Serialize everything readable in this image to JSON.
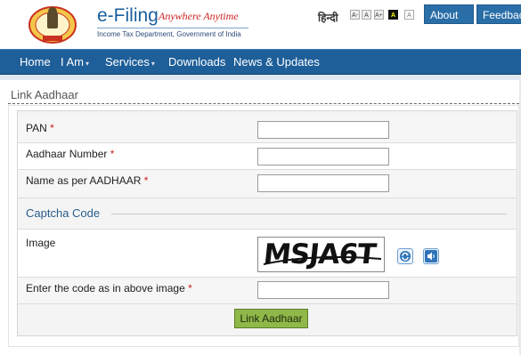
{
  "header": {
    "title": "e-Filing",
    "tagline": "Anywhere Anytime",
    "subtitle": "Income Tax Department, Government of India",
    "language_link": "हिन्दी",
    "font_sizes": [
      "A-",
      "A",
      "A+",
      "A",
      "A"
    ],
    "buttons": {
      "about": "About Us",
      "feedback": "Feedback"
    }
  },
  "nav": {
    "items": [
      {
        "label": "Home"
      },
      {
        "label": "I Am"
      },
      {
        "label": "Services"
      },
      {
        "label": "Downloads"
      },
      {
        "label": "News & Updates"
      }
    ]
  },
  "page": {
    "title": "Link Aadhaar",
    "fields": {
      "pan": {
        "label": "PAN",
        "required": "*",
        "value": ""
      },
      "aadhaar": {
        "label": "Aadhaar Number",
        "required": "*",
        "value": ""
      },
      "name": {
        "label": "Name as per AADHAAR",
        "required": "*",
        "value": ""
      }
    },
    "captcha": {
      "heading": "Captcha Code",
      "image_label": "Image",
      "image_text": "MSJA6T",
      "code_label": "Enter the code as in above image",
      "required": "*",
      "refresh_icon": "refresh-icon",
      "audio_icon": "speaker-icon"
    },
    "submit_label": "Link Aadhaar"
  },
  "colors": {
    "nav_blue": "#1e5f99",
    "title_blue": "#1b5f9e",
    "tagline_red": "#cc2020",
    "button_green": "#8fb849"
  }
}
